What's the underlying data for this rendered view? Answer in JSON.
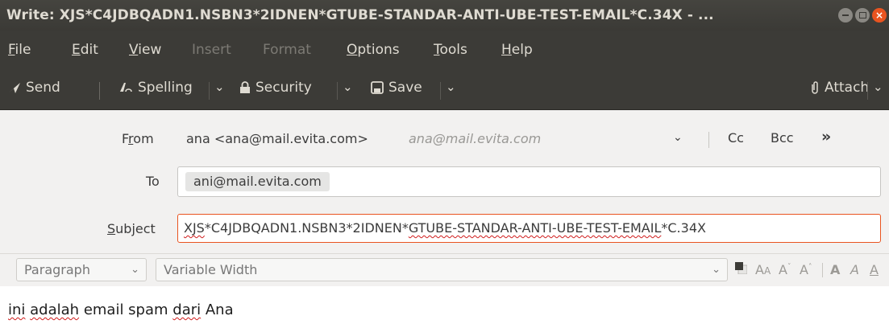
{
  "window": {
    "title": "Write: XJS*C4JDBQADN1.NSBN3*2IDNEN*GTUBE-STANDAR-ANTI-UBE-TEST-EMAIL*C.34X - ...",
    "close_glyph": "×"
  },
  "menu": {
    "items": [
      {
        "label": "File",
        "mnemonic_first": "F",
        "rest": "ile"
      },
      {
        "label": "Edit",
        "mnemonic_first": "E",
        "rest": "dit"
      },
      {
        "label": "View",
        "mnemonic_first": "V",
        "rest": "iew"
      },
      {
        "label": "Insert"
      },
      {
        "label": "Format"
      },
      {
        "label": "Options",
        "mnemonic_first": "O",
        "rest": "ptions"
      },
      {
        "label": "Tools",
        "mnemonic_first": "T",
        "rest": "ools"
      },
      {
        "label": "Help",
        "mnemonic_first": "H",
        "rest": "elp"
      }
    ]
  },
  "toolbar": {
    "send": "Send",
    "spelling": "Spelling",
    "security": "Security",
    "save": "Save",
    "attach": "Attach",
    "dropdown_glyph": "⌄"
  },
  "headers": {
    "from_label_pre": "F",
    "from_label_mn": "r",
    "from_label_post": "om",
    "from_value": "ana <ana@mail.evita.com>",
    "from_hint": "ana@mail.evita.com",
    "cc": "Cc",
    "bcc": "Bcc",
    "more": "»",
    "to_label": "To",
    "to_recipient": "ani@mail.evita.com",
    "subject_label_mn": "S",
    "subject_label_rest": "ubject",
    "subject_parts": {
      "p1": "XJS",
      "p2": "*C4JDBQADN1.NSBN3*2IDNEN*",
      "p3": "GTUBE-STANDAR-ANTI-UBE-TEST-EMAIL",
      "p4": "*C.34X"
    }
  },
  "format": {
    "paragraph": "Paragraph",
    "font": "Variable Width",
    "chevron": "⌄",
    "text_color": "#3c3b37",
    "bg_color": "#ffffff"
  },
  "body": {
    "w1": "ini",
    "w2": "adalah",
    "w3": " email spam ",
    "w4": "dari",
    "w5": " Ana"
  },
  "colors": {
    "accent": "#e95420",
    "chrome": "#3c3b37",
    "spell_error": "#d01b1b"
  }
}
